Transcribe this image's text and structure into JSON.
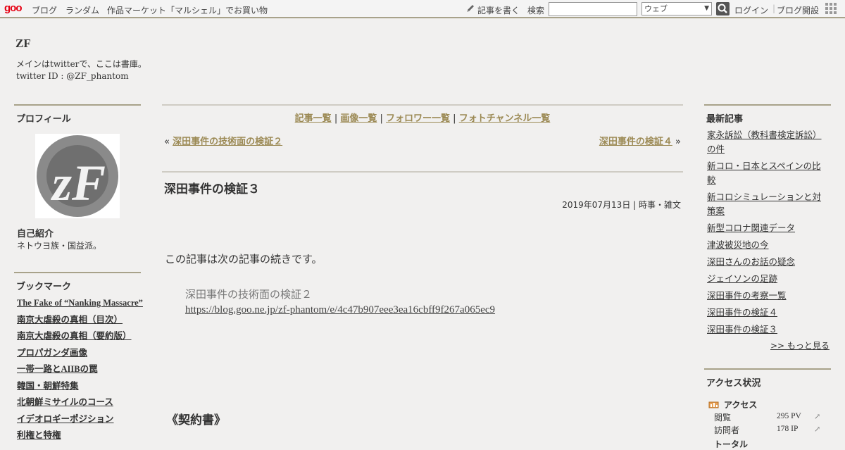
{
  "topbar": {
    "logo": "goo",
    "nav": [
      "ブログ",
      "ランダム",
      "作品マーケット「マルシェル」でお買い物"
    ],
    "write": "記事を書く",
    "search_label": "検索",
    "search_value": "",
    "select_value": "ウェブ",
    "login": "ログイン",
    "open_blog": "ブログ開設"
  },
  "header": {
    "title": "ZF",
    "desc_line1": "メインはtwitterで、ここは書庫。",
    "desc_line2": "twitter ID : @ZF_phantom"
  },
  "profile": {
    "heading": "プロフィール",
    "intro_label": "自己紹介",
    "intro_text": "ネトウヨ族・国益派。"
  },
  "bookmarks": {
    "heading": "ブックマーク",
    "items": [
      "The Fake of “Nanking Massacre”",
      "南京大虐殺の真相（目次）",
      "南京大虐殺の真相（要約版）",
      "プロパガンダ画像",
      "一帯一路とAIIBの罠",
      "韓国・朝鮮特集",
      "北朝鮮ミサイルのコース",
      "イデオロギーポジション",
      "利権と特権"
    ]
  },
  "main": {
    "nav": [
      "記事一覧",
      "画像一覧",
      "フォロワー一覧",
      "フォトチャンネル一覧"
    ],
    "nav_sep": " | ",
    "prev_mark": "«",
    "prev_link": "深田事件の技術面の検証２",
    "next_link": "深田事件の検証４",
    "next_mark": "»",
    "title": "深田事件の検証３",
    "meta": "2019年07月13日 | 時事・雑文",
    "lead": "この記事は次の記事の続きです。",
    "quote_title": "深田事件の技術面の検証２",
    "quote_url": "https://blog.goo.ne.jp/zf-phantom/e/4c47b907eee3ea16cbff9f267a065ec9",
    "section": "《契約書》"
  },
  "recent": {
    "heading": "最新記事",
    "items": [
      "家永訴訟（教科書検定訴訟）の件",
      "新コロ・日本とスペインの比較",
      "新コロシミュレーションと対策案",
      "新型コロナ関連データ",
      "津波被災地の今",
      "深田さんのお話の疑念",
      "ジェイソンの足跡",
      "深田事件の考察一覧",
      "深田事件の検証４",
      "深田事件の検証３"
    ],
    "more": ">> もっと見る"
  },
  "access": {
    "heading": "アクセス状況",
    "title": "アクセス",
    "rows": [
      {
        "label": "閲覧",
        "value": "295 PV"
      },
      {
        "label": "訪問者",
        "value": "178 IP"
      }
    ],
    "total_label": "トータル"
  },
  "colors": {
    "accent_rule": "#a8a28a",
    "link_gold": "#9c8a55",
    "background": "#f1f0ef"
  }
}
